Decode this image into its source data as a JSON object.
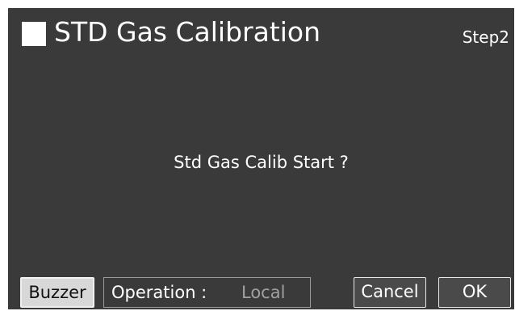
{
  "header": {
    "title": "STD Gas Calibration",
    "step": "Step2"
  },
  "main": {
    "message": "Std Gas Calib Start ?"
  },
  "footer": {
    "buzzer_label": "Buzzer",
    "operation_label": "Operation :",
    "operation_value": "Local",
    "cancel_label": "Cancel",
    "ok_label": "OK"
  },
  "colors": {
    "background": "#3a3a3a",
    "text": "#ffffff",
    "muted_text": "#a0a0a0",
    "buzzer_button": "#d8d8d8"
  },
  "icons": {
    "title_marker": "square-icon"
  }
}
